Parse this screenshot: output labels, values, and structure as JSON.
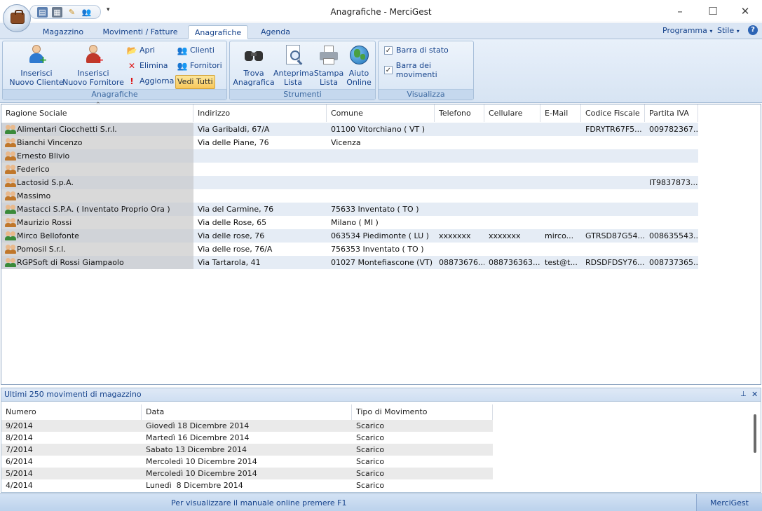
{
  "window": {
    "title": "Anagrafiche - MerciGest"
  },
  "tabs": [
    {
      "label": "Magazzino"
    },
    {
      "label": "Movimenti / Fatture"
    },
    {
      "label": "Anagrafiche"
    },
    {
      "label": "Agenda"
    }
  ],
  "right_menu": {
    "programma": "Programma",
    "stile": "Stile",
    "help": "?"
  },
  "ribbon": {
    "anagrafiche": {
      "caption": "Anagrafiche",
      "inserisci_cliente": "Inserisci\nNuovo Cliente",
      "inserisci_fornitore": "Inserisci\nNuovo Fornitore",
      "apri": "Apri",
      "elimina": "Elimina",
      "aggiorna": "Aggiorna",
      "clienti": "Clienti",
      "fornitori": "Fornitori",
      "vedi_tutti": "Vedi Tutti"
    },
    "strumenti": {
      "caption": "Strumenti",
      "trova": "Trova\nAnagrafica",
      "anteprima": "Anteprima\nLista",
      "stampa": "Stampa\nLista",
      "aiuto": "Aiuto\nOnline"
    },
    "visualizza": {
      "caption": "Visualizza",
      "barra_stato": "Barra di stato",
      "barra_movimenti": "Barra dei movimenti"
    }
  },
  "grid": {
    "columns": [
      "Ragione Sociale",
      "Indirizzo",
      "Comune",
      "Telefono",
      "Cellulare",
      "E-Mail",
      "Codice Fiscale",
      "Partita IVA"
    ],
    "rows": [
      {
        "type": "cliente",
        "ragione": "Alimentari Ciocchetti S.r.l.",
        "indirizzo": "Via Garibaldi, 67/A",
        "comune": "01100 Vitorchiano ( VT )",
        "telefono": "",
        "cellulare": "",
        "email": "",
        "cf": "FDRYTR67F5...",
        "piva": "009782367..."
      },
      {
        "type": "fornitore",
        "ragione": "Bianchi Vincenzo",
        "indirizzo": "Via delle Piane, 76",
        "comune": "Vicenza",
        "telefono": "",
        "cellulare": "",
        "email": "",
        "cf": "",
        "piva": ""
      },
      {
        "type": "fornitore",
        "ragione": "Ernesto Blivio",
        "indirizzo": "",
        "comune": "",
        "telefono": "",
        "cellulare": "",
        "email": "",
        "cf": "",
        "piva": ""
      },
      {
        "type": "fornitore",
        "ragione": "Federico",
        "indirizzo": "",
        "comune": "",
        "telefono": "",
        "cellulare": "",
        "email": "",
        "cf": "",
        "piva": ""
      },
      {
        "type": "fornitore",
        "ragione": "Lactosid S.p.A.",
        "indirizzo": "",
        "comune": "",
        "telefono": "",
        "cellulare": "",
        "email": "",
        "cf": "",
        "piva": "IT9837873..."
      },
      {
        "type": "fornitore",
        "ragione": "Massimo",
        "indirizzo": "",
        "comune": "",
        "telefono": "",
        "cellulare": "",
        "email": "",
        "cf": "",
        "piva": ""
      },
      {
        "type": "cliente",
        "ragione": "Mastacci S.P.A. ( Inventato Proprio Ora )",
        "indirizzo": "Via del Carmine, 76",
        "comune": "75633 Inventato ( TO )",
        "telefono": "",
        "cellulare": "",
        "email": "",
        "cf": "",
        "piva": ""
      },
      {
        "type": "fornitore",
        "ragione": "Maurizio Rossi",
        "indirizzo": "Via delle Rose, 65",
        "comune": "Milano ( MI )",
        "telefono": "",
        "cellulare": "",
        "email": "",
        "cf": "",
        "piva": ""
      },
      {
        "type": "cliente",
        "ragione": "Mirco Bellofonte",
        "indirizzo": "Via delle rose, 76",
        "comune": "063534 Piedimonte ( LU )",
        "telefono": "xxxxxxx",
        "cellulare": "xxxxxxx",
        "email": "mirco...",
        "cf": "GTRSD87G54...",
        "piva": "008635543..."
      },
      {
        "type": "fornitore",
        "ragione": "Pomosil S.r.l.",
        "indirizzo": "Via delle rose, 76/A",
        "comune": "756353 Inventato ( TO )",
        "telefono": "",
        "cellulare": "",
        "email": "",
        "cf": "",
        "piva": ""
      },
      {
        "type": "cliente",
        "ragione": "RGPSoft di Rossi Giampaolo",
        "indirizzo": "Via Tartarola, 41",
        "comune": "01027 Montefiascone (VT)",
        "telefono": "08873676...",
        "cellulare": "088736363...",
        "email": "test@t...",
        "cf": "RDSDFDSY76...",
        "piva": "008737365..."
      }
    ]
  },
  "movimenti": {
    "title": "Ultimi 250 movimenti di magazzino",
    "columns": [
      "Numero",
      "Data",
      "Tipo di Movimento"
    ],
    "rows": [
      {
        "numero": "9/2014",
        "data": "Giovedì 18 Dicembre 2014",
        "tipo": "Scarico"
      },
      {
        "numero": "8/2014",
        "data": "Martedì 16 Dicembre 2014",
        "tipo": "Scarico"
      },
      {
        "numero": "7/2014",
        "data": "Sabato 13 Dicembre 2014",
        "tipo": "Scarico"
      },
      {
        "numero": "6/2014",
        "data": "Mercoledì 10 Dicembre 2014",
        "tipo": "Scarico"
      },
      {
        "numero": "5/2014",
        "data": "Mercoledì 10 Dicembre 2014",
        "tipo": "Scarico"
      },
      {
        "numero": "4/2014",
        "data": "Lunedì  8 Dicembre 2014",
        "tipo": "Scarico"
      }
    ]
  },
  "status": {
    "message": "Per visualizzare il manuale online premere F1",
    "app": "MerciGest"
  },
  "colors": {
    "accent": "#15428b",
    "ribbon": "#dce8f6",
    "row_alt": "#e5ecf5"
  }
}
